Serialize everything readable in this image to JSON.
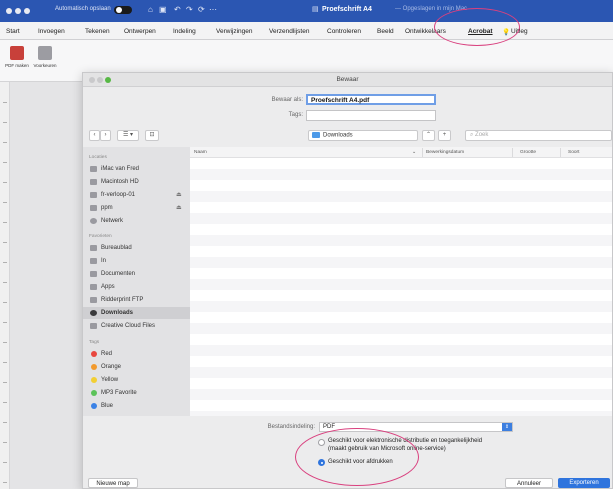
{
  "titlebar": {
    "autosave_label": "Automatisch opslaan",
    "autosave_state": "aan",
    "document_title": "Proefschrift A4",
    "document_subtitle": "— Opgeslagen in mijn Mac"
  },
  "menu": {
    "items": [
      "Start",
      "Invoegen",
      "Tekenen",
      "Ontwerpen",
      "Indeling",
      "Verwijzingen",
      "Verzendlijsten",
      "Controleren",
      "Beeld",
      "Ontwikkelaars",
      "Acrobat",
      "Uitleg"
    ],
    "active": "Acrobat"
  },
  "ribbon": {
    "buttons": [
      {
        "label": "PDF maken",
        "icon": "pdf-create-icon"
      },
      {
        "label": "Voorkeuren",
        "icon": "preferences-icon"
      }
    ]
  },
  "dialog": {
    "title": "Bewaar",
    "save_as_label": "Bewaar als:",
    "save_as_value": "Proefschrift A4.pdf",
    "tags_label": "Tags:",
    "tags_value": "",
    "location": "Downloads",
    "search_placeholder": "Zoek",
    "nav": {
      "back": "‹",
      "forward": "›",
      "view": "☰ ▾",
      "newfolder": "⊡",
      "chevron": "⌃",
      "plus": "+"
    },
    "sidebar": {
      "locations_header": "Locaties",
      "locations": [
        {
          "label": "iMac van Fred",
          "eject": false
        },
        {
          "label": "Macintosh HD",
          "eject": false
        },
        {
          "label": "fr-verloop-01",
          "eject": true
        },
        {
          "label": "ppm",
          "eject": true
        },
        {
          "label": "Netwerk",
          "eject": false
        }
      ],
      "favorites_header": "Favorieten",
      "favorites": [
        "Bureaublad",
        "In",
        "Documenten",
        "Apps",
        "Ridderprint FTP",
        "Downloads",
        "Creative Cloud Files"
      ],
      "selected": "Downloads",
      "tags_header": "Tags",
      "tags": [
        {
          "label": "Red",
          "color": "#e8473f"
        },
        {
          "label": "Orange",
          "color": "#f29a2e"
        },
        {
          "label": "Yellow",
          "color": "#f2cf34"
        },
        {
          "label": "MP3 Favorite",
          "color": "#5cc35a"
        },
        {
          "label": "Blue",
          "color": "#3b82e6"
        }
      ]
    },
    "columns": [
      "Naam",
      "Bewerkingsdatum",
      "Grootte",
      "Soort"
    ],
    "format_label": "Bestandsindeling:",
    "format_value": "PDF",
    "option_electronic": "Geschikt voor elektronische distributie en toegankelijkheid",
    "option_electronic_note": "(maakt gebruik van Microsoft online-service)",
    "option_print": "Geschikt voor afdrukken",
    "selected_option": "print",
    "new_folder_button": "Nieuwe map",
    "cancel_button": "Annuleer",
    "export_button": "Exporteren"
  },
  "colors": {
    "titlebar": "#2b56b2",
    "accent": "#2f74dd",
    "highlight_circle": "#d9417f"
  }
}
